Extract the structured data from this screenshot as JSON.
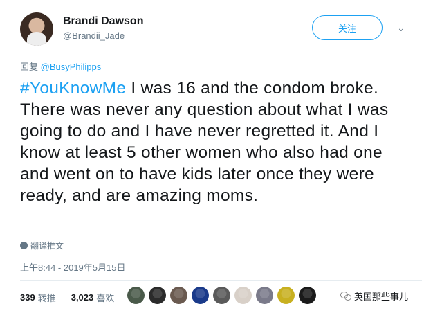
{
  "author": {
    "name": "Brandi Dawson",
    "handle": "@Brandii_Jade"
  },
  "follow_label": "关注",
  "reply": {
    "prefix": "回复",
    "target": "@BusyPhilipps"
  },
  "tweet": {
    "hashtag": "#YouKnowMe",
    "text": " I was 16 and the condom broke. There was never any question about what I was going to do and I have never regretted it. And I know at least 5 other women who also had one and went on to have kids later once they were ready, and are amazing moms."
  },
  "translate_label": "翻译推文",
  "timestamp": "上午8:44 - 2019年5月15日",
  "stats": {
    "retweets_count": "339",
    "retweets_label": "转推",
    "likes_count": "3,023",
    "likes_label": "喜欢"
  },
  "liker_colors": [
    "#4a5a4a",
    "#2b2b2b",
    "#6a5a50",
    "#1a3a8a",
    "#5a5a5a",
    "#d8d0c8",
    "#7a7a8a",
    "#c8b020",
    "#1a1a1a"
  ],
  "watermark": "英国那些事儿",
  "colors": {
    "accent": "#1da1f2",
    "secondary_text": "#657786"
  }
}
